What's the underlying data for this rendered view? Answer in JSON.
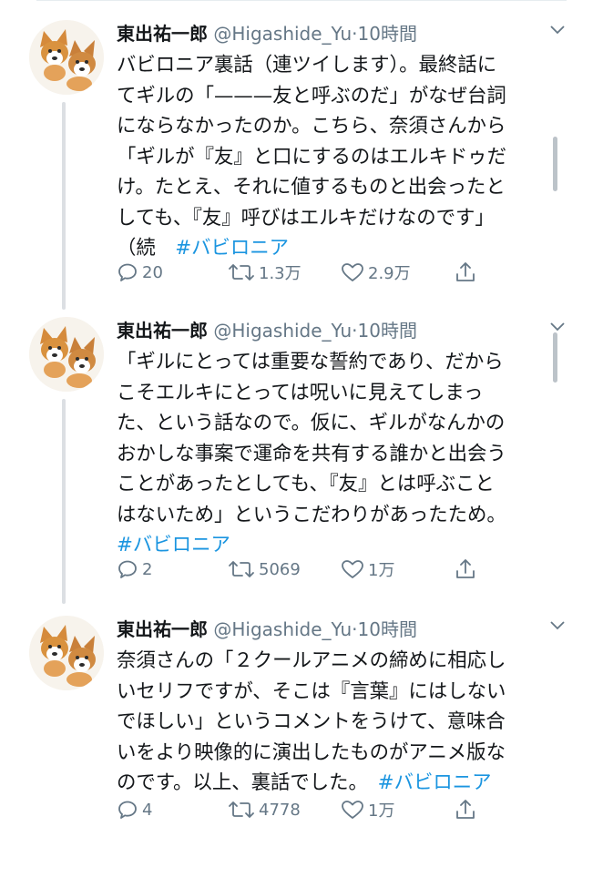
{
  "tweets": [
    {
      "name": "東出祐一郎",
      "handle": "@Higashide_Yu",
      "dot": "·",
      "time": "10時間",
      "lines": [
        "バビロニア裏話（連ツイします）。最終話に",
        "てギルの「———友と呼ぶのだ」がなぜ台詞",
        "にならなかったのか。こちら、奈須さんから",
        "「ギルが『友』と口にするのはエルキドゥだ",
        "け。たとえ、それに値するものと出会ったと",
        "しても、『友』呼びはエルキだけなのです」"
      ],
      "last_line_text": "（続　",
      "hashtag": "#バビロニア",
      "replies": "20",
      "retweets": "1.3万",
      "likes": "2.9万"
    },
    {
      "name": "東出祐一郎",
      "handle": "@Higashide_Yu",
      "dot": "·",
      "time": "10時間",
      "lines": [
        "「ギルにとっては重要な誓約であり、だから",
        "こそエルキにとっては呪いに見えてしまっ",
        "た、という話なので。仮に、ギルがなんかの",
        "おかしな事案で運命を共有する誰かと出会う",
        "ことがあったとしても、『友』とは呼ぶこと",
        "はないため」というこだわりがあったため。"
      ],
      "last_line_text": "",
      "hashtag": "#バビロニア",
      "replies": "2",
      "retweets": "5069",
      "likes": "1万"
    },
    {
      "name": "東出祐一郎",
      "handle": "@Higashide_Yu",
      "dot": "·",
      "time": "10時間",
      "lines": [
        "奈須さんの「２クールアニメの締めに相応し",
        "いセリフですが、そこは『言葉』にはしない",
        "でほしい」というコメントをうけて、意味合",
        "いをより映像的に演出したものがアニメ版な"
      ],
      "last_line_text": "のです。以上、裏話でした。　",
      "hashtag": "#バビロニア",
      "replies": "4",
      "retweets": "4778",
      "likes": "1万"
    }
  ],
  "colors": {
    "text": "#14171a",
    "secondary": "#657786",
    "link": "#1b95e0",
    "thread_line": "#dcdfe3"
  },
  "icons": [
    "reply-icon",
    "retweet-icon",
    "like-icon",
    "share-icon",
    "chevron-down-icon",
    "avatar-corgi-image"
  ]
}
